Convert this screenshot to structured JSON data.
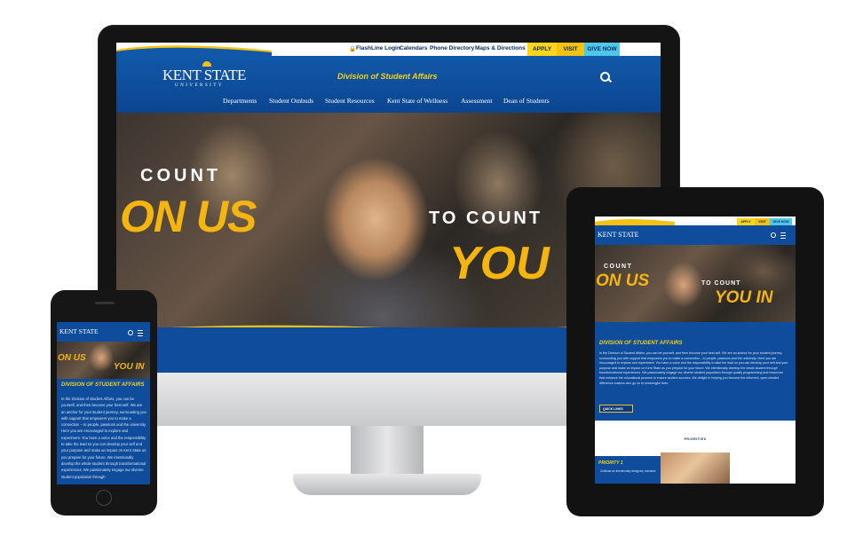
{
  "desktop": {
    "topbar": {
      "links": [
        "FlashLine Login",
        "Calendars",
        "Phone Directory",
        "Maps & Directions"
      ],
      "apply": "APPLY",
      "visit": "VISIT",
      "give": "GIVE NOW"
    },
    "logo": {
      "name": "KENT STATE",
      "sub": "UNIVERSITY"
    },
    "division": "Division of Student Affairs",
    "nav": [
      "Departments",
      "Student Ombuds",
      "Student Resources",
      "Kent State of Wellness",
      "Assessment",
      "Dean of Students"
    ],
    "hero": {
      "line1": "COUNT",
      "line2": "ON US",
      "line3": "TO COUNT",
      "line4": "YOU"
    }
  },
  "tablet": {
    "topbar": {
      "apply": "APPLY",
      "visit": "VISIT",
      "give": "GIVE NOW"
    },
    "logo": "KENT STATE",
    "hero": {
      "line1": "COUNT",
      "line2": "ON US",
      "line3": "TO COUNT",
      "line4": "YOU IN"
    },
    "title": "DIVISION OF STUDENT AFFAIRS",
    "body": "In the Division of Student Affairs, you can be yourself, and then become your best self. We are an anchor for your student journey, surrounding you with support that empowers you to make a connection – to people, passions and the university. Here you are encouraged to explore and experiment. You have a voice and the responsibility to take the lead so you can develop your self and your purpose and make an impact on Kent State as you prepare for your future. We intentionally develop the whole student through transformational experiences. We passionately engage our diverse student population through quality programming and resources that enhance the educational process to ensure student success. We delight in helping you become the informed, open-minded difference-makers who go on to meaningful lives.",
    "button": "QUICK LINKS",
    "priorities_label": "PRIORITIES",
    "priority": "PRIORITY 1",
    "priority_text": "Cultivate an intentionally designed, inclusive"
  },
  "phone": {
    "logo": "KENT STATE",
    "hero": {
      "line2": "ON US",
      "line4": "YOU IN"
    },
    "title": "DIVISION OF STUDENT AFFAIRS",
    "body": "In the Division of Student Affairs, you can be yourself, and then become your best self. We are an anchor for your student journey, surrounding you with support that empowers you to make a connection – to people, passions and the university. Here you are encouraged to explore and experiment. You have a voice and the responsibility to take the lead so you can develop your self and your purpose and make an impact on Kent State as you prepare for your future. We intentionally develop the whole student through transformational experiences. We passionately engage our diverse student population through"
  },
  "colors": {
    "brand_blue": "#0f4c9c",
    "brand_gold": "#f3d21b",
    "apply_yellow": "#fbd51a",
    "give_blue": "#4ec7e8"
  },
  "icons": [
    "lock-icon",
    "search-icon",
    "menu-icon",
    "sun-logo-icon"
  ]
}
